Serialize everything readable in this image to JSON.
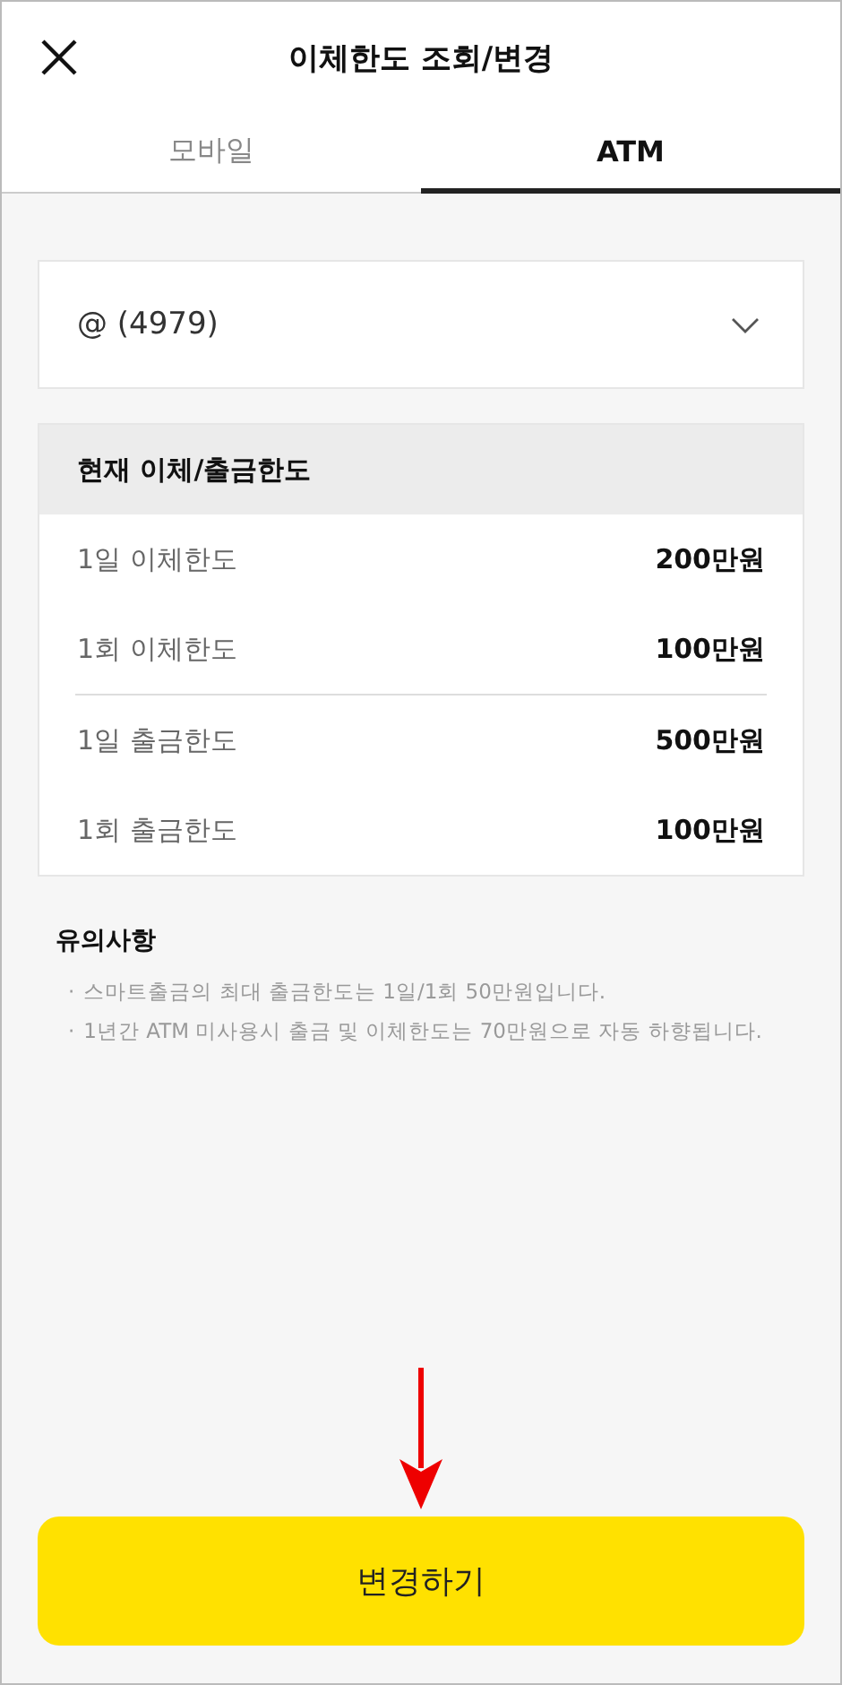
{
  "header": {
    "title": "이체한도 조회/변경"
  },
  "tabs": [
    {
      "label": "모바일",
      "selected": false
    },
    {
      "label": "ATM",
      "selected": true
    }
  ],
  "account_select": {
    "value": "@ (4979)"
  },
  "limits": {
    "title": "현재 이체/출금한도",
    "groups": [
      {
        "rows": [
          {
            "label": "1일 이체한도",
            "value": "200만원"
          },
          {
            "label": "1회 이체한도",
            "value": "100만원"
          }
        ]
      },
      {
        "rows": [
          {
            "label": "1일 출금한도",
            "value": "500만원"
          },
          {
            "label": "1회 출금한도",
            "value": "100만원"
          }
        ]
      }
    ]
  },
  "notes": {
    "title": "유의사항",
    "items": [
      "스마트출금의 최대 출금한도는 1일/1회 50만원입니다.",
      "1년간 ATM 미사용시 출금 및 이체한도는 70만원으로 자동 하향됩니다."
    ]
  },
  "bullet": "·",
  "submit_button": {
    "label": "변경하기"
  }
}
